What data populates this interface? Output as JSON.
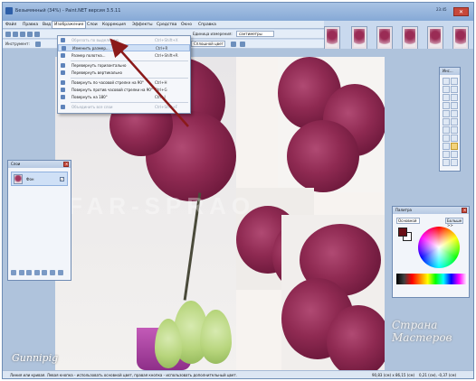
{
  "window": {
    "title": "Безымянный (34%) - Paint.NET версия 3.5.11",
    "clock": "23:45"
  },
  "menu": [
    "Файл",
    "Правка",
    "Вид",
    "Изображение",
    "Слои",
    "Коррекция",
    "Эффекты",
    "Средства",
    "Окно",
    "Справка"
  ],
  "toolbar": {
    "tool_label": "Инструмент:",
    "units_label": "Единица измерения:",
    "units_value": "сантиметры",
    "fill_value": "Сплошной цвет"
  },
  "image_menu": [
    {
      "label": "Обрезать по выделению",
      "shortcut": "Ctrl+Shift+X",
      "disabled": true
    },
    {
      "label": "Изменить размер...",
      "shortcut": "Ctrl+R",
      "highlighted": true
    },
    {
      "label": "Размер полотна...",
      "shortcut": "Ctrl+Shift+R"
    },
    {
      "separator": true
    },
    {
      "label": "Перевернуть горизонтально",
      "shortcut": ""
    },
    {
      "label": "Перевернуть вертикально",
      "shortcut": ""
    },
    {
      "separator": true
    },
    {
      "label": "Повернуть по часовой стрелке на 90°",
      "shortcut": "Ctrl+H"
    },
    {
      "label": "Повернуть против часовой стрелки на 90°",
      "shortcut": "Ctrl+G"
    },
    {
      "label": "Повернуть на 180°",
      "shortcut": "Ctrl+J"
    },
    {
      "separator": true
    },
    {
      "label": "Объединить все слои",
      "shortcut": "Ctrl+Shift+F",
      "disabled": true
    }
  ],
  "layers_panel": {
    "title": "Слои",
    "layer_name": "Фон",
    "layer_checked": "✓"
  },
  "tools_panel": {
    "title": "Инс..."
  },
  "palette_panel": {
    "title": "Палитра",
    "mode": "Основной",
    "more_button": "Больше >>"
  },
  "canvas": {
    "watermark": "FAR-SPRAO"
  },
  "signature": "Gunnipig",
  "site_watermark": "Страна Мастеров",
  "statusbar": {
    "hint": "Линия или кривая. Левая кнопка - использовать основной цвет, правая кнопка - использовать дополнительный цвет.",
    "size": "90,83 (см) x 86,15 (см)",
    "position": "0,21 (см), -0,37 (см)"
  }
}
